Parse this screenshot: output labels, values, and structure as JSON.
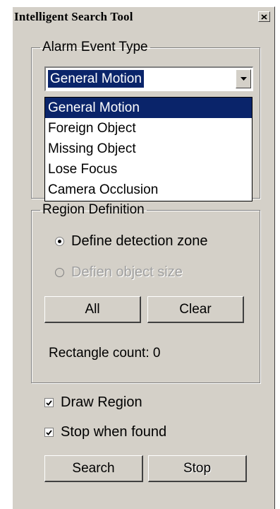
{
  "window": {
    "title": "Intelligent Search Tool"
  },
  "alarm_group": {
    "legend": "Alarm Event Type",
    "selected": "General Motion",
    "options": [
      "General Motion",
      "Foreign Object",
      "Missing Object",
      "Lose Focus",
      "Camera Occlusion"
    ]
  },
  "region_group": {
    "legend": "Region Definition",
    "radio_define_zone": {
      "label": "Define detection zone",
      "checked": true
    },
    "radio_object_size": {
      "label": "Defien object size",
      "checked": false,
      "enabled": false
    },
    "all_button": "All",
    "clear_button": "Clear",
    "rectangle_count_label": "Rectangle count: 0"
  },
  "options": {
    "draw_region": {
      "label": "Draw Region",
      "checked": true
    },
    "stop_when_found": {
      "label": "Stop when found",
      "checked": true
    }
  },
  "actions": {
    "search_button": "Search",
    "stop_button": "Stop"
  },
  "colors": {
    "face": "#d4d0c8",
    "highlight": "#0a246a"
  },
  "icons": {
    "close": "close-icon",
    "dropdown_arrow": "chevron-down-icon"
  }
}
